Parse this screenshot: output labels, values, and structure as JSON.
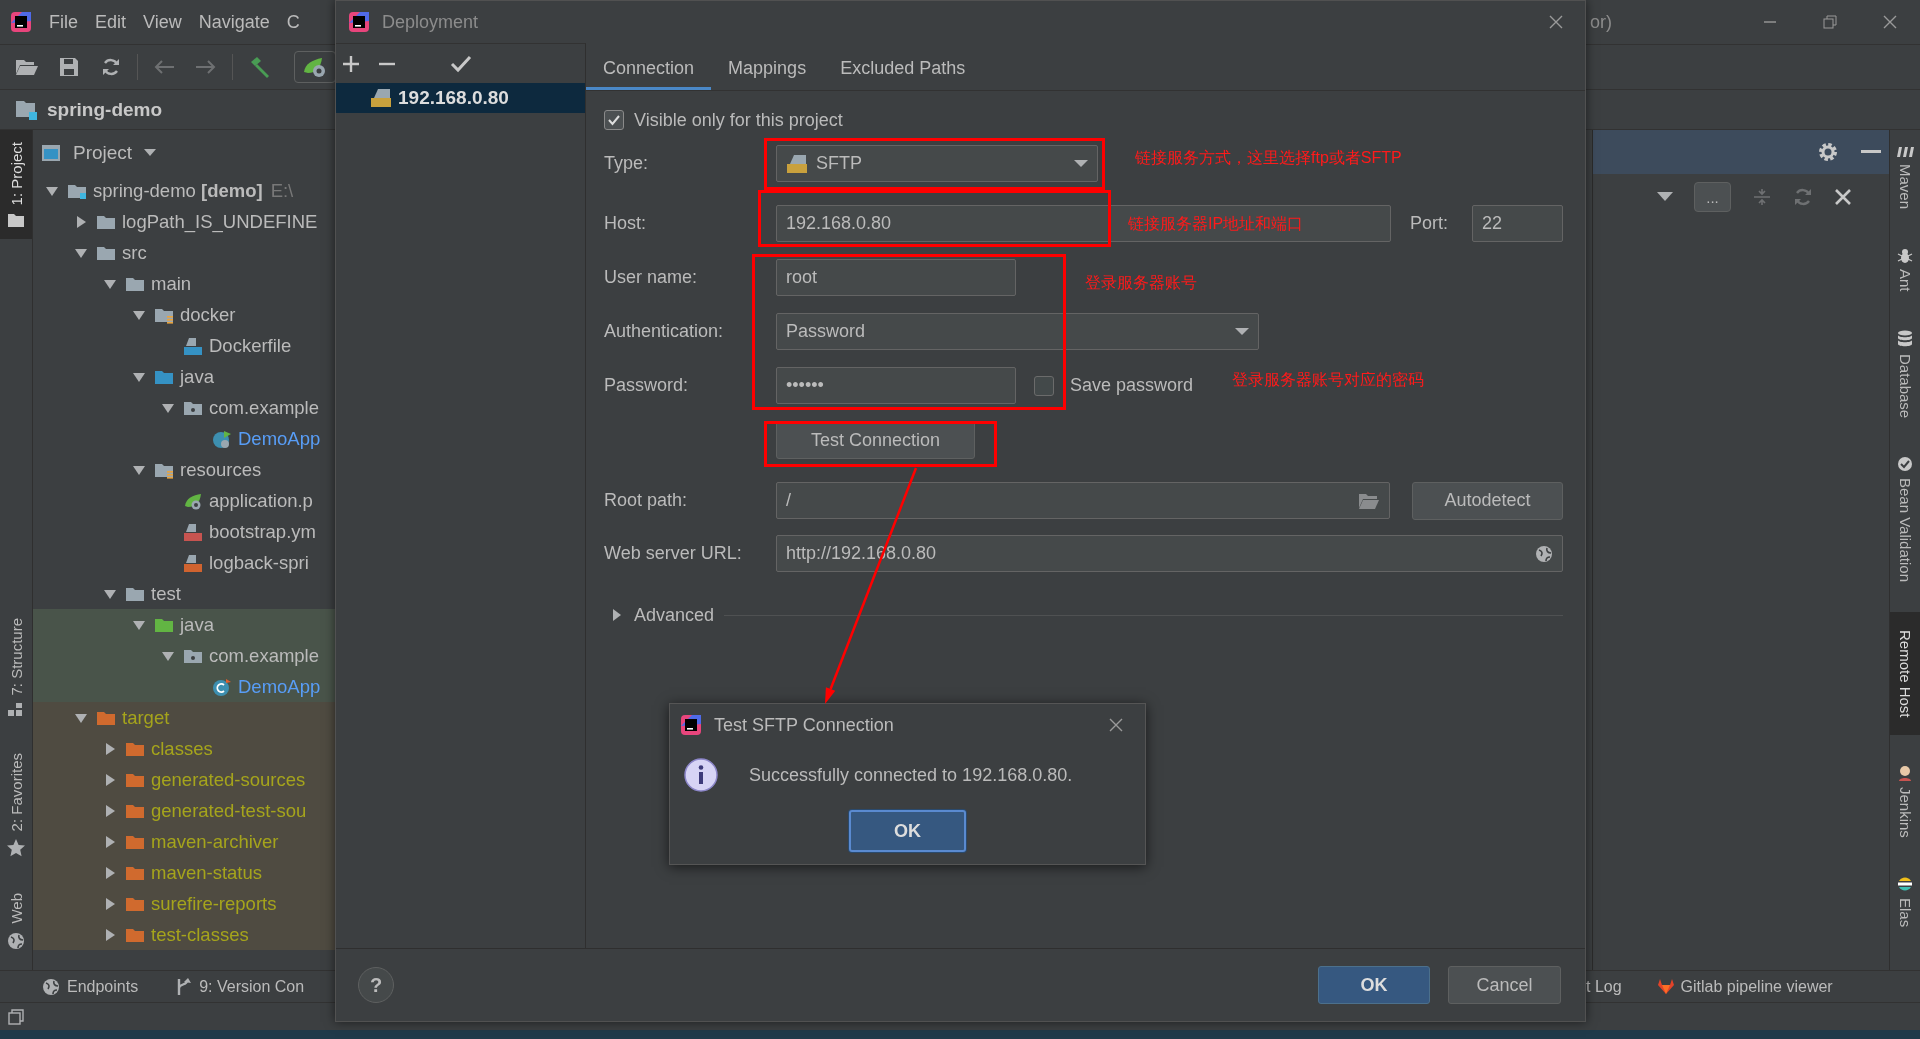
{
  "ide": {
    "menu": [
      {
        "label": "File"
      },
      {
        "label": "Edit"
      },
      {
        "label": "View"
      },
      {
        "label": "Navigate"
      },
      {
        "label": "C"
      }
    ],
    "title_fragment": "or)",
    "breadcrumb": "spring-demo",
    "project_view": "Project",
    "left_tool_tabs": [
      {
        "label": "1: Project",
        "kind": "project",
        "selected": true
      },
      {
        "label": "7: Structure",
        "kind": "structure",
        "selected": false
      },
      {
        "label": "2: Favorites",
        "kind": "favorites",
        "selected": false
      },
      {
        "label": "Web",
        "kind": "web",
        "selected": false
      }
    ],
    "tree": [
      {
        "label": "spring-demo **[demo]**",
        "path": "E:\\",
        "kind": "module",
        "expanded": true,
        "children": [
          {
            "label": "logPath_IS_UNDEFINE",
            "kind": "folder",
            "expanded": false
          },
          {
            "label": "src",
            "kind": "folder",
            "expanded": true,
            "children": [
              {
                "label": "main",
                "kind": "folder",
                "expanded": true,
                "children": [
                  {
                    "label": "docker",
                    "kind": "resource-folder",
                    "expanded": true,
                    "children": [
                      {
                        "label": "Dockerfile",
                        "kind": "docker-file"
                      }
                    ]
                  },
                  {
                    "label": "java",
                    "kind": "source-folder",
                    "expanded": true,
                    "children": [
                      {
                        "label": "com.example",
                        "kind": "package",
                        "expanded": true,
                        "children": [
                          {
                            "label": "DemoApp",
                            "kind": "spring-class"
                          }
                        ]
                      }
                    ]
                  },
                  {
                    "label": "resources",
                    "kind": "resource-folder",
                    "expanded": true,
                    "children": [
                      {
                        "label": "application.p",
                        "kind": "spring-config"
                      },
                      {
                        "label": "bootstrap.ym",
                        "kind": "yaml-file"
                      },
                      {
                        "label": "logback-spri",
                        "kind": "xml-file"
                      }
                    ]
                  }
                ]
              },
              {
                "label": "test",
                "kind": "folder",
                "expanded": true,
                "children": [
                  {
                    "label": "java",
                    "kind": "test-folder",
                    "color": "#49544a",
                    "expanded": true,
                    "children": [
                      {
                        "label": "com.example",
                        "kind": "package",
                        "color": "#49544a",
                        "expanded": true,
                        "children": [
                          {
                            "label": "DemoApp",
                            "kind": "class",
                            "color": "#49544a"
                          }
                        ]
                      }
                    ]
                  }
                ]
              }
            ]
          },
          {
            "label": "target",
            "kind": "excluded-folder",
            "color": "#4f4b41",
            "expanded": true,
            "children": [
              {
                "label": "classes",
                "kind": "excluded-folder",
                "color": "#4f4b41",
                "expanded": false
              },
              {
                "label": "generated-sources",
                "kind": "excluded-folder",
                "color": "#4f4b41",
                "expanded": false
              },
              {
                "label": "generated-test-sou",
                "kind": "excluded-folder",
                "color": "#4f4b41",
                "expanded": false
              },
              {
                "label": "maven-archiver",
                "kind": "excluded-folder",
                "color": "#4f4b41",
                "expanded": false
              },
              {
                "label": "maven-status",
                "kind": "excluded-folder",
                "color": "#4f4b41",
                "expanded": false
              },
              {
                "label": "surefire-reports",
                "kind": "excluded-folder",
                "color": "#4f4b41",
                "expanded": false
              },
              {
                "label": "test-classes",
                "kind": "excluded-folder",
                "color": "#4f4b41",
                "expanded": false
              }
            ]
          }
        ]
      }
    ],
    "remote_host_panel": {
      "browse_button": "..."
    },
    "right_tool_tabs": [
      {
        "label": "Maven",
        "kind": "maven",
        "selected": false
      },
      {
        "label": "Ant",
        "kind": "ant",
        "selected": false
      },
      {
        "label": "Database",
        "kind": "database",
        "selected": false
      },
      {
        "label": "Bean Validation",
        "kind": "bean",
        "selected": false
      },
      {
        "label": "Remote Host",
        "kind": "plain",
        "selected": true
      },
      {
        "label": "Jenkins",
        "kind": "jenkins",
        "selected": false
      },
      {
        "label": "Elas",
        "kind": "elastic",
        "selected": false
      }
    ],
    "bottom_tabs_left": [
      {
        "label": "Endpoints",
        "kind": "endpoints"
      },
      {
        "label": "9: Version Con",
        "kind": "vcs"
      }
    ],
    "bottom_tabs_right": [
      {
        "label": "t Log",
        "kind": "plain"
      },
      {
        "label": "Gitlab pipeline viewer",
        "kind": "gitlab"
      }
    ]
  },
  "deployment_dialog": {
    "title": "Deployment",
    "servers": [
      {
        "name": "192.168.0.80",
        "selected": true
      }
    ],
    "tabs": [
      {
        "label": "Connection",
        "selected": true
      },
      {
        "label": "Mappings",
        "selected": false
      },
      {
        "label": "Excluded Paths",
        "selected": false
      }
    ],
    "visible_only": {
      "label": "Visible only for this project",
      "checked": true
    },
    "type": {
      "label": "Type:",
      "value": "SFTP"
    },
    "host": {
      "label": "Host:",
      "value": "192.168.0.80"
    },
    "port": {
      "label": "Port:",
      "value": "22"
    },
    "user_name": {
      "label": "User name:",
      "value": "root"
    },
    "authentication": {
      "label": "Authentication:",
      "value": "Password"
    },
    "password": {
      "label": "Password:",
      "value": "••••••"
    },
    "save_password": {
      "label": "Save password",
      "checked": false
    },
    "test_button": "Test Connection",
    "root_path": {
      "label": "Root path:",
      "value": "/"
    },
    "autodetect_button": "Autodetect",
    "web_server_url": {
      "label": "Web server URL:",
      "value": "http://192.168.0.80"
    },
    "advanced": {
      "label": "Advanced",
      "expanded": false
    },
    "help_button": "?",
    "ok_button": "OK",
    "cancel_button": "Cancel"
  },
  "test_dialog": {
    "title": "Test SFTP Connection",
    "message": "Successfully connected to 192.168.0.80.",
    "ok_button": "OK"
  },
  "annotations": [
    {
      "text": "链接服务方式，这里选择ftp或者SFTP"
    },
    {
      "text": "链接服务器IP地址和端口"
    },
    {
      "text": "登录服务器账号"
    },
    {
      "text": "登录服务器账号对应的密码"
    }
  ]
}
